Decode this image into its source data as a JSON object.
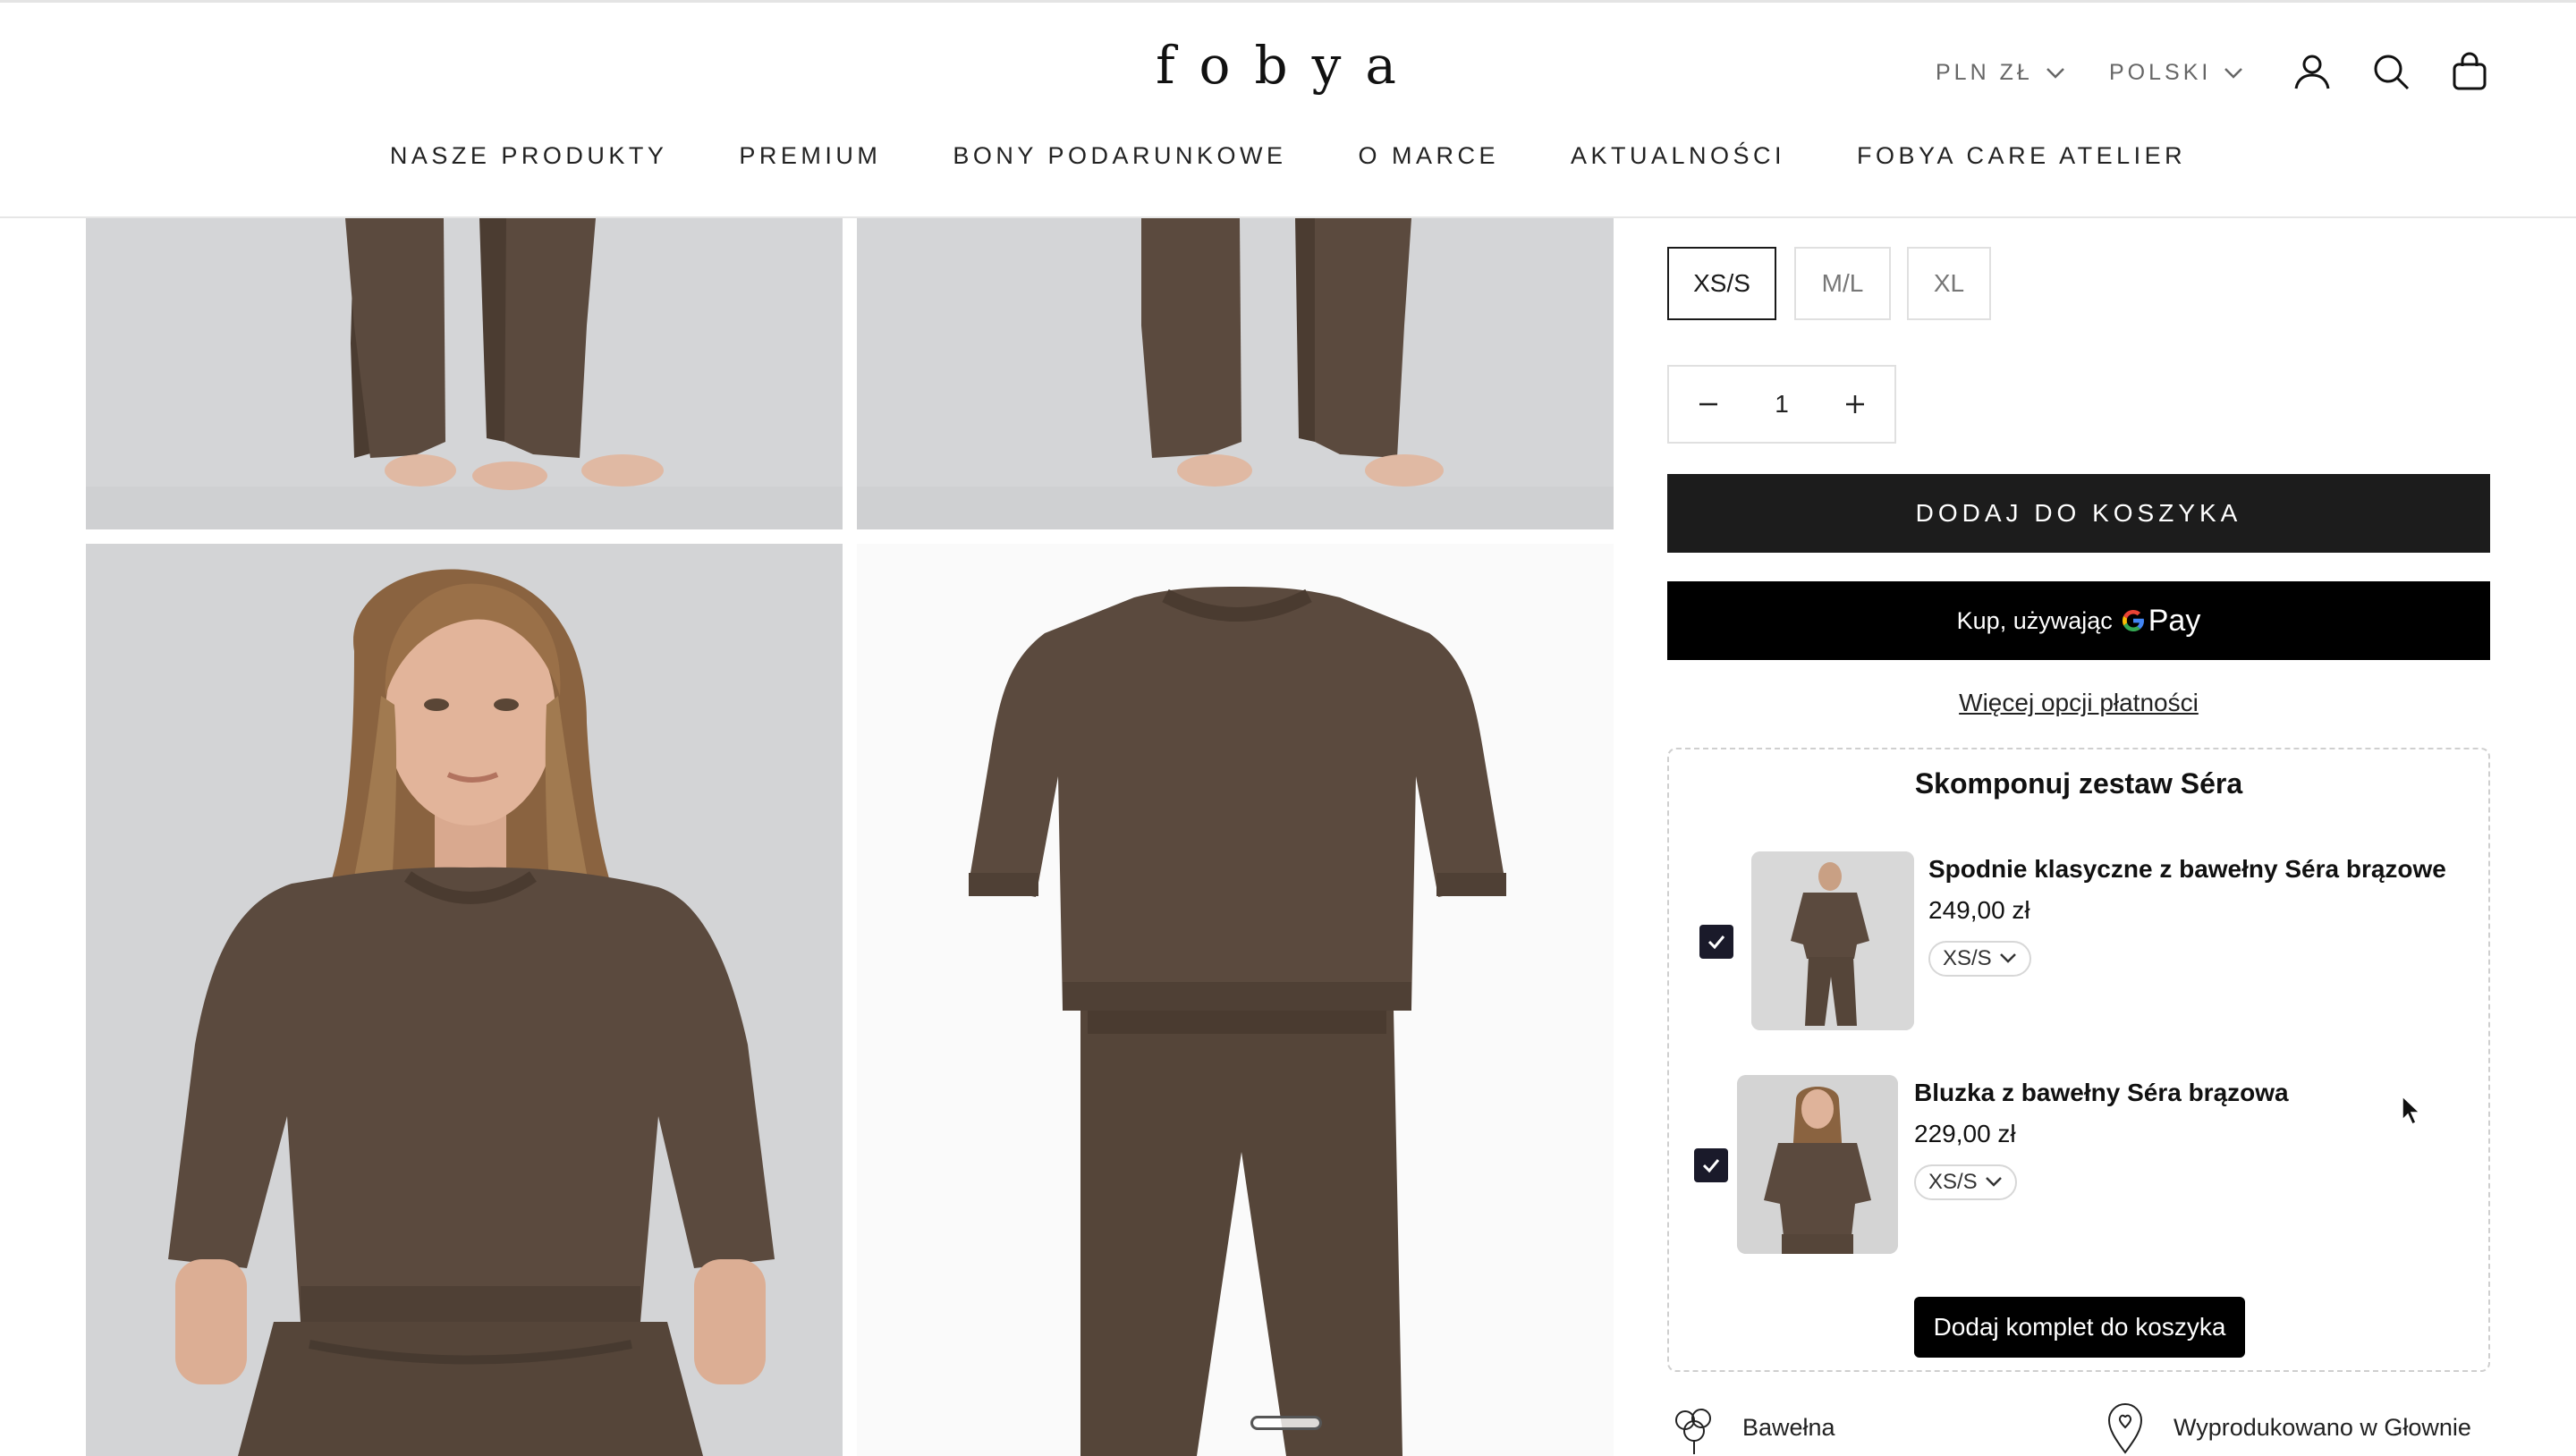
{
  "header": {
    "logo": "fobya",
    "currency": "PLN ZŁ",
    "language": "POLSKI",
    "icons": [
      "account-icon",
      "search-icon",
      "bag-icon"
    ],
    "nav": [
      "NASZE PRODUKTY",
      "PREMIUM",
      "BONY PODARUNKOWE",
      "O MARCE",
      "AKTUALNOŚCI",
      "FOBYA CARE ATELIER"
    ]
  },
  "product": {
    "sizes": [
      "XS/S",
      "M/L",
      "XL"
    ],
    "selected_size": "XS/S",
    "quantity": "1",
    "add_to_cart": "DODAJ DO KOSZYKA",
    "gpay_prefix": "Kup, używając",
    "gpay_pay": "Pay",
    "more_payment": "Więcej opcji płatności"
  },
  "bundle": {
    "title": "Skomponuj zestaw Séra",
    "items": [
      {
        "name": "Spodnie klasyczne z bawełny Séra brązowe",
        "price": "249,00 zł",
        "size": "XS/S",
        "checked": true
      },
      {
        "name": "Bluzka z bawełny Séra brązowa",
        "price": "229,00 zł",
        "size": "XS/S",
        "checked": true
      }
    ],
    "add_button": "Dodaj komplet do koszyka"
  },
  "features": [
    "Bawełna",
    "Wyprodukowano w Głownie"
  ],
  "colors": {
    "garment": "#5b4a3e",
    "garment_dark": "#4a3b30",
    "photo_bg": "#d4d5d7",
    "button": "#1c1c1c"
  }
}
